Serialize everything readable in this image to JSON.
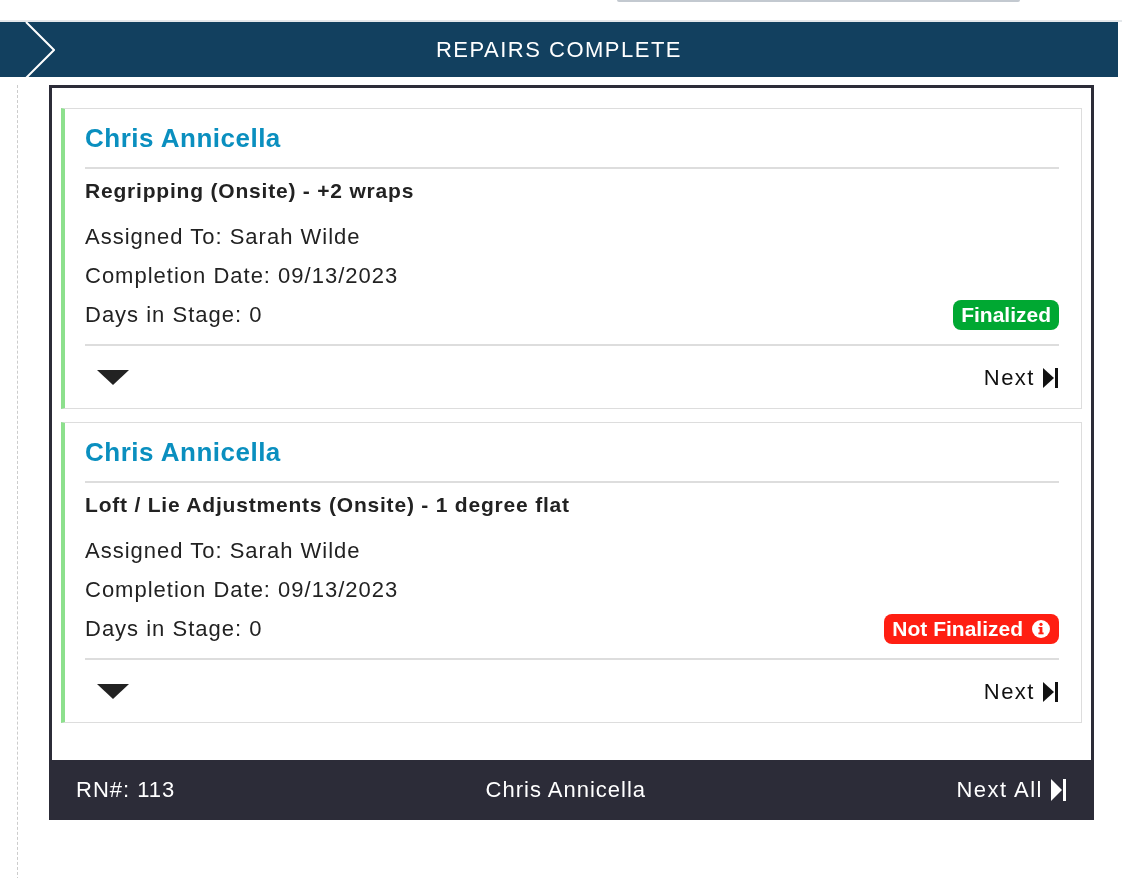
{
  "header": {
    "title": "REPAIRS COMPLETE"
  },
  "cards": [
    {
      "customer": "Chris Annicella",
      "service": "Regripping (Onsite) - +2 wraps",
      "assigned": "Assigned To: Sarah Wilde",
      "completion": "Completion Date: 09/13/2023",
      "days": "Days in Stage: 0",
      "status": {
        "label": "Finalized",
        "kind": "finalized"
      },
      "next": "Next"
    },
    {
      "customer": "Chris Annicella",
      "service": "Loft / Lie Adjustments (Onsite) - 1 degree flat",
      "assigned": "Assigned To: Sarah Wilde",
      "completion": "Completion Date: 09/13/2023",
      "days": "Days in Stage: 0",
      "status": {
        "label": "Not Finalized",
        "kind": "not_finalized"
      },
      "next": "Next"
    }
  ],
  "footer": {
    "rn": "RN#: 113",
    "customer": "Chris Annicella",
    "next_all": "Next All"
  }
}
